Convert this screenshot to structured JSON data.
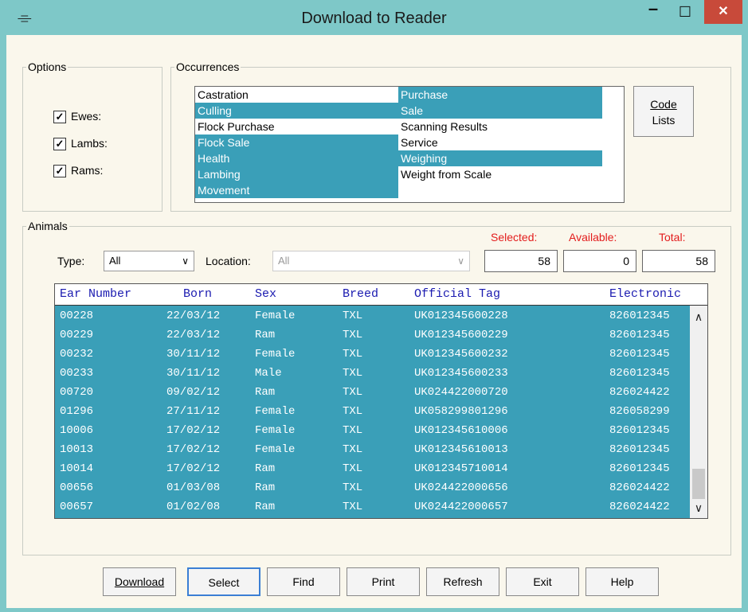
{
  "window": {
    "title": "Download to Reader",
    "minimize": "–",
    "maximize": "☐",
    "close": "✕",
    "app_icon": "ear-tag-icon"
  },
  "options": {
    "legend": "Options",
    "items": [
      {
        "label": "Ewes:",
        "checked": true
      },
      {
        "label": "Lambs:",
        "checked": true
      },
      {
        "label": "Rams:",
        "checked": true
      }
    ]
  },
  "occurrences": {
    "legend": "Occurrences",
    "col1": [
      {
        "label": "Castration",
        "selected": false
      },
      {
        "label": "Culling",
        "selected": true
      },
      {
        "label": "Flock Purchase",
        "selected": false
      },
      {
        "label": "Flock Sale",
        "selected": true
      },
      {
        "label": "Health",
        "selected": true
      },
      {
        "label": "Lambing",
        "selected": true
      },
      {
        "label": "Movement",
        "selected": true
      }
    ],
    "col2": [
      {
        "label": "Purchase",
        "selected": true
      },
      {
        "label": "Sale",
        "selected": true
      },
      {
        "label": "Scanning Results",
        "selected": false
      },
      {
        "label": "Service",
        "selected": false
      },
      {
        "label": "Weighing",
        "selected": true
      },
      {
        "label": "Weight from Scale",
        "selected": false
      }
    ],
    "code_lists_line1": "Code",
    "code_lists_line2": "Lists"
  },
  "animals": {
    "legend": "Animals",
    "type_label": "Type:",
    "type_value": "All",
    "location_label": "Location:",
    "location_value": "All",
    "selected_label": "Selected:",
    "available_label": "Available:",
    "total_label": "Total:",
    "selected_value": "58",
    "available_value": "0",
    "total_value": "58",
    "columns": [
      "Ear Number",
      "Born",
      "Sex",
      "Breed",
      "Official Tag",
      "Electronic"
    ],
    "rows": [
      [
        "00228",
        "22/03/12",
        "Female",
        "TXL",
        "UK012345600228",
        "826012345"
      ],
      [
        "00229",
        "22/03/12",
        "Ram",
        "TXL",
        "UK012345600229",
        "826012345"
      ],
      [
        "00232",
        "30/11/12",
        "Female",
        "TXL",
        "UK012345600232",
        "826012345"
      ],
      [
        "00233",
        "30/11/12",
        "Male",
        "TXL",
        "UK012345600233",
        "826012345"
      ],
      [
        "00720",
        "09/02/12",
        "Ram",
        "TXL",
        "UK024422000720",
        "826024422"
      ],
      [
        "01296",
        "27/11/12",
        "Female",
        "TXL",
        "UK058299801296",
        "826058299"
      ],
      [
        "10006",
        "17/02/12",
        "Female",
        "TXL",
        "UK012345610006",
        "826012345"
      ],
      [
        "10013",
        "17/02/12",
        "Female",
        "TXL",
        "UK012345610013",
        "826012345"
      ],
      [
        "10014",
        "17/02/12",
        "Ram",
        "TXL",
        "UK012345710014",
        "826012345"
      ],
      [
        "00656",
        "01/03/08",
        "Ram",
        "TXL",
        "UK024422000656",
        "826024422"
      ],
      [
        "00657",
        "01/02/08",
        "Ram",
        "TXL",
        "UK024422000657",
        "826024422"
      ]
    ]
  },
  "buttons": {
    "download": "Download",
    "select": "Select",
    "find": "Find",
    "print": "Print",
    "refresh": "Refresh",
    "exit": "Exit",
    "help": "Help"
  },
  "colors": {
    "selection": "#3a9fb8",
    "titlebar": "#7ec8c8",
    "close": "#c84a3a",
    "count_label": "#e31c1c",
    "header_text": "#1a1ab0"
  }
}
